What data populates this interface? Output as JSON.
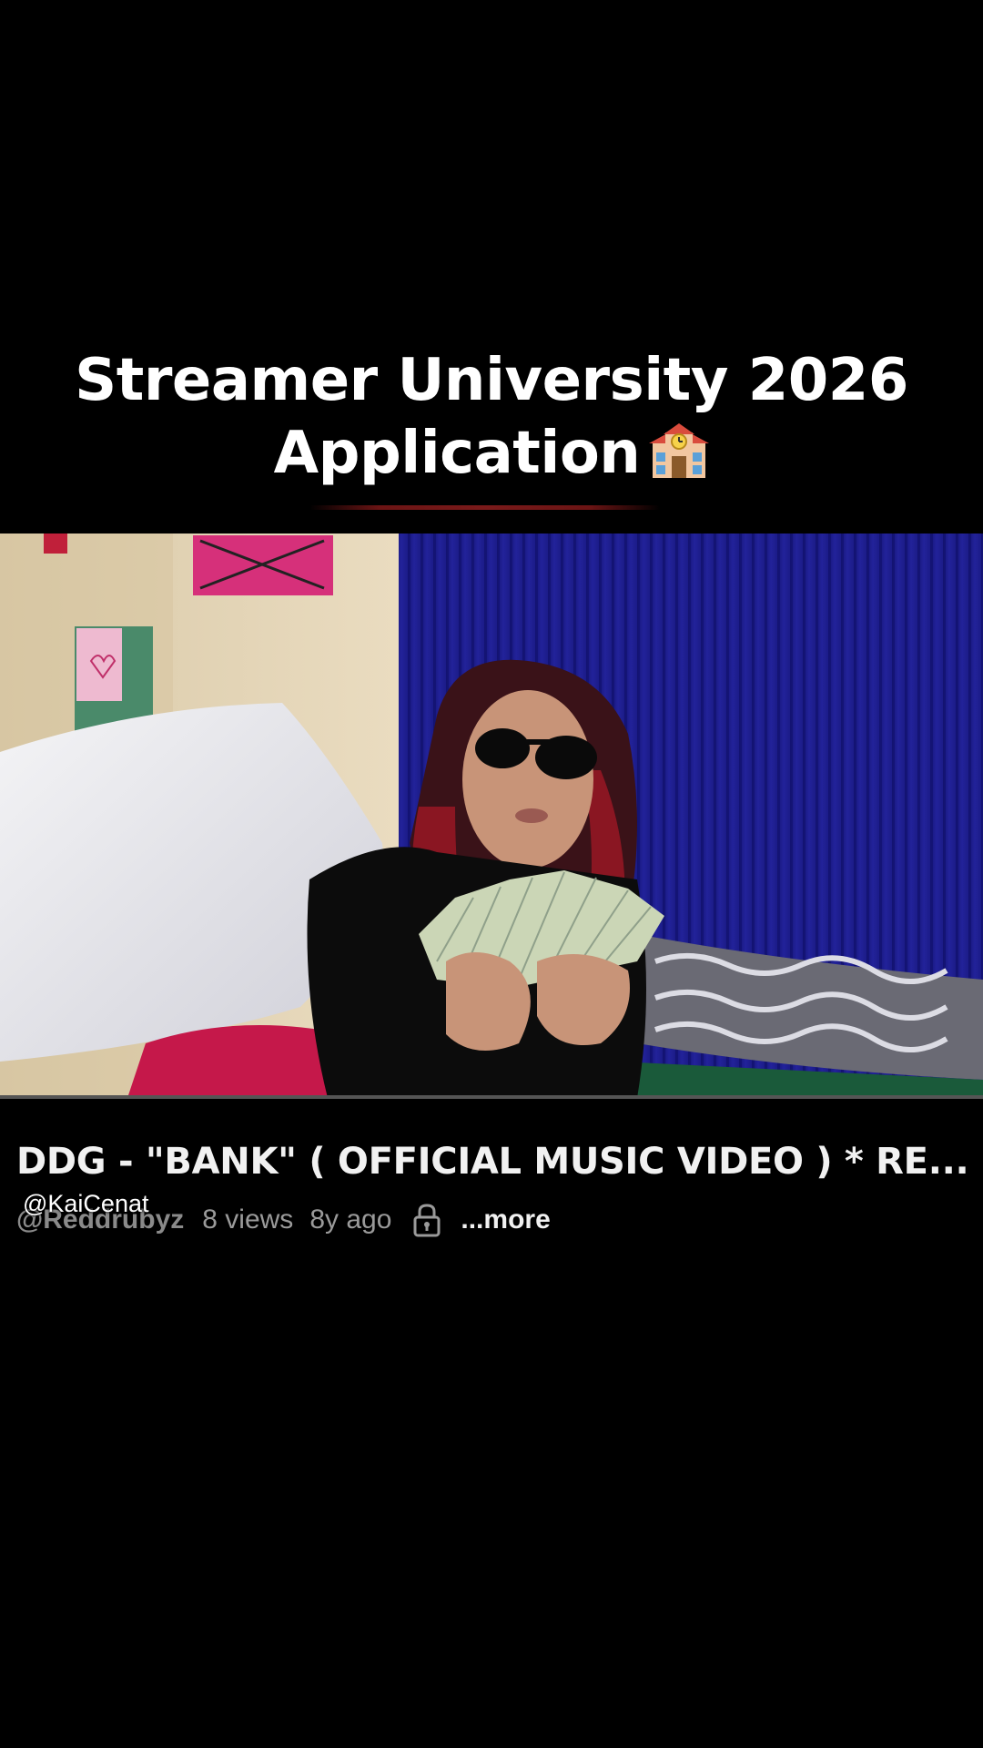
{
  "caption": {
    "line1": "Streamer University 2026",
    "line2": "Application",
    "emoji_icon": "school-icon"
  },
  "video": {
    "title": "DDG - \"BANK\" ( OFFICIAL MUSIC VIDEO ) * RE...",
    "channel": "@Reddrubyz",
    "views": "8 views",
    "age": "8y ago",
    "lock_icon": "lock-icon",
    "more_label": "...more"
  },
  "overlay": {
    "handle": "@KaiCenat"
  },
  "colors": {
    "background": "#000000",
    "curtain": "#1b1b8a",
    "wall": "#e8d8b8",
    "caption_text": "#ffffff",
    "meta_text": "#9a9a9a"
  }
}
